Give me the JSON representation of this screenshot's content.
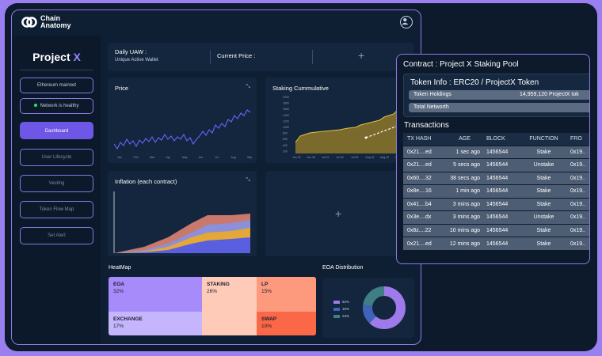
{
  "brand": {
    "name_line1": "Chain",
    "name_line2": "Anatomy"
  },
  "sidebar": {
    "project_name": "Project",
    "project_mark": "X",
    "network": "Ethereum mainnet",
    "status": "Network is healthy",
    "items": [
      {
        "label": "Dashboard",
        "active": true
      },
      {
        "label": "User Lifecycle"
      },
      {
        "label": "Vesting"
      },
      {
        "label": "Token Flow Map"
      },
      {
        "label": "Set Alert"
      }
    ]
  },
  "stats": {
    "daily_uaw_label": "Daily UAW :",
    "daily_uaw_sub": "Unique Active Wallet",
    "current_price_label": "Current Price :",
    "add_symbol": "+"
  },
  "cards": {
    "price_title": "Price",
    "staking_title": "Staking Cummulative",
    "inflation_title": "Inflation (each contract)",
    "expand_icon": "expand-icon",
    "empty_add": "+"
  },
  "price_chart": {
    "x_ticks": [
      "Jan",
      "Feb",
      "Mar",
      "Apr",
      "May",
      "Jun",
      "Jul",
      "Aug",
      "Sep"
    ]
  },
  "staking_chart": {
    "y_ticks": [
      "2000",
      "1800",
      "1600",
      "1400",
      "1200",
      "1000",
      "800",
      "600",
      "400",
      "200"
    ],
    "x_ticks": [
      "Jun 29",
      "Jun 30",
      "Jul 01",
      "Jul 02",
      "Jul 03",
      "Aug 21",
      "Aug 22",
      "Oct 20"
    ]
  },
  "heatmap": {
    "title": "HeatMap",
    "cells": [
      {
        "label": "EOA",
        "pct": "32%",
        "color": "#a78bfa"
      },
      {
        "label": "STAKING",
        "pct": "26%",
        "color": "#fdcbb8"
      },
      {
        "label": "LP",
        "pct": "15%",
        "color": "#fd9a7d"
      },
      {
        "label": "EXCHANGE",
        "pct": "17%",
        "color": "#c4b5fd"
      },
      {
        "label": "SWAP",
        "pct": "10%",
        "color": "#fb6848"
      }
    ]
  },
  "eoa": {
    "title": "EOA Distribution",
    "legend": [
      {
        "label": "62%",
        "color": "#9f7aea"
      },
      {
        "label": "15%",
        "color": "#3f63b8"
      },
      {
        "label": "23%",
        "color": "#3f7f83"
      }
    ]
  },
  "panel": {
    "title": "Contract : Project X Staking Pool",
    "token_info": "Token Info : ERC20 / ProjectX Token",
    "holdings_label": "Token Holdings",
    "holdings_value": "14,959,120 ProjectX tok",
    "networth_label": "Total Networth",
    "transactions_title": "Transactions",
    "columns": [
      "TX HASH",
      "AGE",
      "BLOCK",
      "FUNCTION",
      "FRO"
    ],
    "rows": [
      {
        "hash": "0x21....ed",
        "age": "1 sec ago",
        "block": "1456544",
        "fn": "Stake",
        "from": "0x19.."
      },
      {
        "hash": "0x21....ed",
        "age": "5 secs ago",
        "block": "1456544",
        "fn": "Unstake",
        "from": "0x19.."
      },
      {
        "hash": "0x60....32",
        "age": "38 secs ago",
        "block": "1456544",
        "fn": "Stake",
        "from": "0x19.."
      },
      {
        "hash": "0x8e....16",
        "age": "1 min ago",
        "block": "1456544",
        "fn": "Stake",
        "from": "0x19.."
      },
      {
        "hash": "0x41....b4",
        "age": "3 mins ago",
        "block": "1456544",
        "fn": "Stake",
        "from": "0x19.."
      },
      {
        "hash": "0x3e....dx",
        "age": "3 mins ago",
        "block": "1456544",
        "fn": "Unstake",
        "from": "0x19.."
      },
      {
        "hash": "0x8z....22",
        "age": "10 mins ago",
        "block": "1456544",
        "fn": "Stake",
        "from": "0x19.."
      },
      {
        "hash": "0x21....ed",
        "age": "12 mins ago",
        "block": "1456544",
        "fn": "Stake",
        "from": "0x19.."
      }
    ]
  }
}
